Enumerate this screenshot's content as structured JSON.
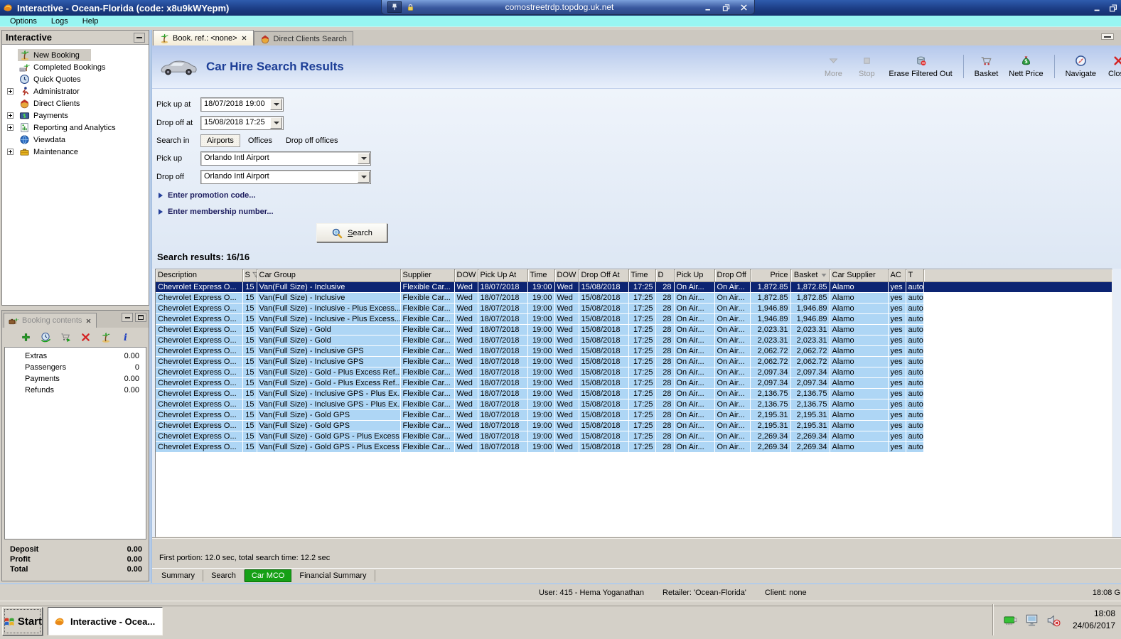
{
  "window": {
    "title": "Interactive - Ocean-Florida (code: x8u9kWYepm)"
  },
  "rdp_bar": {
    "host": "comostreetrdp.topdog.uk.net"
  },
  "menu": {
    "items": [
      "Options",
      "Logs",
      "Help"
    ]
  },
  "sidebar": {
    "title": "Interactive",
    "items": [
      {
        "icon": "palm",
        "label": "New Booking",
        "selected": true
      },
      {
        "icon": "palm-money",
        "label": "Completed Bookings"
      },
      {
        "icon": "clock",
        "label": "Quick Quotes"
      },
      {
        "icon": "runner",
        "label": "Administrator",
        "expandable": true
      },
      {
        "icon": "clients",
        "label": "Direct Clients"
      },
      {
        "icon": "payments",
        "label": "Payments",
        "expandable": true
      },
      {
        "icon": "report",
        "label": "Reporting and Analytics",
        "expandable": true
      },
      {
        "icon": "globe",
        "label": "Viewdata"
      },
      {
        "icon": "toolbox",
        "label": "Maintenance",
        "expandable": true
      }
    ]
  },
  "booking_panel": {
    "title": "Booking contents",
    "toolbar": [
      {
        "icon": "add",
        "name": "add-item-button"
      },
      {
        "icon": "world-clock",
        "name": "availability-button"
      },
      {
        "icon": "cart-add",
        "name": "add-to-basket-button"
      },
      {
        "icon": "close-red",
        "name": "delete-item-button"
      },
      {
        "icon": "palm",
        "name": "booking-button"
      },
      {
        "icon": "info",
        "name": "info-button"
      }
    ],
    "rows": [
      {
        "label": "Extras",
        "value": "0.00"
      },
      {
        "label": "Passengers",
        "value": "0"
      },
      {
        "label": "Payments",
        "value": "0.00"
      },
      {
        "label": "Refunds",
        "value": "0.00"
      }
    ],
    "totals": [
      {
        "label": "Deposit",
        "value": "0.00"
      },
      {
        "label": "Profit",
        "value": "0.00"
      },
      {
        "label": "Total",
        "value": "0.00"
      }
    ]
  },
  "tabs": [
    {
      "icon": "palm",
      "label": "Book. ref.: <none>",
      "active": true,
      "closable": true
    },
    {
      "icon": "clients",
      "label": "Direct Clients Search"
    }
  ],
  "page": {
    "title": "Car Hire Search Results",
    "toolbar": [
      {
        "icon": "more",
        "label": "More",
        "disabled": true
      },
      {
        "icon": "stop",
        "label": "Stop",
        "disabled": true
      },
      {
        "icon": "erase",
        "label": "Erase Filtered Out"
      },
      {
        "icon": "basket",
        "label": "Basket",
        "sep": true
      },
      {
        "icon": "nett",
        "label": "Nett Price"
      },
      {
        "icon": "navigate",
        "label": "Navigate",
        "sep": true
      },
      {
        "icon": "close-red",
        "label": "Close"
      }
    ]
  },
  "form": {
    "pickup_at": {
      "label": "Pick up at",
      "value": "18/07/2018 19:00"
    },
    "dropoff_at": {
      "label": "Drop off at",
      "value": "15/08/2018 17:25"
    },
    "search_in": {
      "label": "Search in",
      "options": [
        {
          "label": "Airports",
          "selected": true
        },
        {
          "label": "Offices"
        },
        {
          "label": "Drop off offices"
        }
      ]
    },
    "pickup": {
      "label": "Pick up",
      "value": "Orlando Intl Airport"
    },
    "dropoff": {
      "label": "Drop off",
      "value": "Orlando Intl Airport"
    },
    "promo": "Enter promotion code...",
    "membership": "Enter membership number...",
    "search_button": "Search"
  },
  "results": {
    "summary": "Search results: 16/16",
    "columns": [
      {
        "label": "Description"
      },
      {
        "label": "S",
        "icon": "filter"
      },
      {
        "label": "Car Group"
      },
      {
        "label": "Supplier"
      },
      {
        "label": "DOW"
      },
      {
        "label": "Pick Up At"
      },
      {
        "label": "Time"
      },
      {
        "label": "DOW"
      },
      {
        "label": "Drop Off At"
      },
      {
        "label": "Time"
      },
      {
        "label": "D"
      },
      {
        "label": "Pick Up"
      },
      {
        "label": "Drop Off"
      },
      {
        "label": "Price"
      },
      {
        "label": "Basket",
        "icon": "sort-desc"
      },
      {
        "label": "Car Supplier"
      },
      {
        "label": "AC"
      },
      {
        "label": "T"
      }
    ],
    "selected_row": 0,
    "rows": [
      [
        "Chevrolet Express O...",
        "15",
        "Van(Full Size) - Inclusive",
        "Flexible Car...",
        "Wed",
        "18/07/2018",
        "19:00",
        "Wed",
        "15/08/2018",
        "17:25",
        "28",
        "On Air...",
        "On Air...",
        "1,872.85",
        "1,872.85",
        "Alamo",
        "yes",
        "auto"
      ],
      [
        "Chevrolet Express O...",
        "15",
        "Van(Full Size) - Inclusive",
        "Flexible Car...",
        "Wed",
        "18/07/2018",
        "19:00",
        "Wed",
        "15/08/2018",
        "17:25",
        "28",
        "On Air...",
        "On Air...",
        "1,872.85",
        "1,872.85",
        "Alamo",
        "yes",
        "auto"
      ],
      [
        "Chevrolet Express O...",
        "15",
        "Van(Full Size) - Inclusive - Plus Excess...",
        "Flexible Car...",
        "Wed",
        "18/07/2018",
        "19:00",
        "Wed",
        "15/08/2018",
        "17:25",
        "28",
        "On Air...",
        "On Air...",
        "1,946.89",
        "1,946.89",
        "Alamo",
        "yes",
        "auto"
      ],
      [
        "Chevrolet Express O...",
        "15",
        "Van(Full Size) - Inclusive - Plus Excess...",
        "Flexible Car...",
        "Wed",
        "18/07/2018",
        "19:00",
        "Wed",
        "15/08/2018",
        "17:25",
        "28",
        "On Air...",
        "On Air...",
        "1,946.89",
        "1,946.89",
        "Alamo",
        "yes",
        "auto"
      ],
      [
        "Chevrolet Express O...",
        "15",
        "Van(Full Size) - Gold",
        "Flexible Car...",
        "Wed",
        "18/07/2018",
        "19:00",
        "Wed",
        "15/08/2018",
        "17:25",
        "28",
        "On Air...",
        "On Air...",
        "2,023.31",
        "2,023.31",
        "Alamo",
        "yes",
        "auto"
      ],
      [
        "Chevrolet Express O...",
        "15",
        "Van(Full Size) - Gold",
        "Flexible Car...",
        "Wed",
        "18/07/2018",
        "19:00",
        "Wed",
        "15/08/2018",
        "17:25",
        "28",
        "On Air...",
        "On Air...",
        "2,023.31",
        "2,023.31",
        "Alamo",
        "yes",
        "auto"
      ],
      [
        "Chevrolet Express O...",
        "15",
        "Van(Full Size) - Inclusive GPS",
        "Flexible Car...",
        "Wed",
        "18/07/2018",
        "19:00",
        "Wed",
        "15/08/2018",
        "17:25",
        "28",
        "On Air...",
        "On Air...",
        "2,062.72",
        "2,062.72",
        "Alamo",
        "yes",
        "auto"
      ],
      [
        "Chevrolet Express O...",
        "15",
        "Van(Full Size) - Inclusive GPS",
        "Flexible Car...",
        "Wed",
        "18/07/2018",
        "19:00",
        "Wed",
        "15/08/2018",
        "17:25",
        "28",
        "On Air...",
        "On Air...",
        "2,062.72",
        "2,062.72",
        "Alamo",
        "yes",
        "auto"
      ],
      [
        "Chevrolet Express O...",
        "15",
        "Van(Full Size) - Gold - Plus Excess Ref...",
        "Flexible Car...",
        "Wed",
        "18/07/2018",
        "19:00",
        "Wed",
        "15/08/2018",
        "17:25",
        "28",
        "On Air...",
        "On Air...",
        "2,097.34",
        "2,097.34",
        "Alamo",
        "yes",
        "auto"
      ],
      [
        "Chevrolet Express O...",
        "15",
        "Van(Full Size) - Gold - Plus Excess Ref...",
        "Flexible Car...",
        "Wed",
        "18/07/2018",
        "19:00",
        "Wed",
        "15/08/2018",
        "17:25",
        "28",
        "On Air...",
        "On Air...",
        "2,097.34",
        "2,097.34",
        "Alamo",
        "yes",
        "auto"
      ],
      [
        "Chevrolet Express O...",
        "15",
        "Van(Full Size) - Inclusive GPS - Plus Ex...",
        "Flexible Car...",
        "Wed",
        "18/07/2018",
        "19:00",
        "Wed",
        "15/08/2018",
        "17:25",
        "28",
        "On Air...",
        "On Air...",
        "2,136.75",
        "2,136.75",
        "Alamo",
        "yes",
        "auto"
      ],
      [
        "Chevrolet Express O...",
        "15",
        "Van(Full Size) - Inclusive GPS - Plus Ex...",
        "Flexible Car...",
        "Wed",
        "18/07/2018",
        "19:00",
        "Wed",
        "15/08/2018",
        "17:25",
        "28",
        "On Air...",
        "On Air...",
        "2,136.75",
        "2,136.75",
        "Alamo",
        "yes",
        "auto"
      ],
      [
        "Chevrolet Express O...",
        "15",
        "Van(Full Size) - Gold GPS",
        "Flexible Car...",
        "Wed",
        "18/07/2018",
        "19:00",
        "Wed",
        "15/08/2018",
        "17:25",
        "28",
        "On Air...",
        "On Air...",
        "2,195.31",
        "2,195.31",
        "Alamo",
        "yes",
        "auto"
      ],
      [
        "Chevrolet Express O...",
        "15",
        "Van(Full Size) - Gold GPS",
        "Flexible Car...",
        "Wed",
        "18/07/2018",
        "19:00",
        "Wed",
        "15/08/2018",
        "17:25",
        "28",
        "On Air...",
        "On Air...",
        "2,195.31",
        "2,195.31",
        "Alamo",
        "yes",
        "auto"
      ],
      [
        "Chevrolet Express O...",
        "15",
        "Van(Full Size) - Gold GPS - Plus Excess...",
        "Flexible Car...",
        "Wed",
        "18/07/2018",
        "19:00",
        "Wed",
        "15/08/2018",
        "17:25",
        "28",
        "On Air...",
        "On Air...",
        "2,269.34",
        "2,269.34",
        "Alamo",
        "yes",
        "auto"
      ],
      [
        "Chevrolet Express O...",
        "15",
        "Van(Full Size) - Gold GPS - Plus Excess...",
        "Flexible Car...",
        "Wed",
        "18/07/2018",
        "19:00",
        "Wed",
        "15/08/2018",
        "17:25",
        "28",
        "On Air...",
        "On Air...",
        "2,269.34",
        "2,269.34",
        "Alamo",
        "yes",
        "auto"
      ]
    ],
    "status": "First portion: 12.0 sec, total search time: 12.2 sec"
  },
  "bottom_tabs": [
    {
      "label": "Summary"
    },
    {
      "label": "Search"
    },
    {
      "label": "Car MCO",
      "active": true
    },
    {
      "label": "Financial Summary"
    }
  ],
  "status_bar": {
    "user": "User: 415 - Hema Yoganathan",
    "retailer": "Retailer: 'Ocean-Florida'",
    "client": "Client: none",
    "right": "18:08 G"
  },
  "taskbar": {
    "start": "Start",
    "task": "Interactive - Ocea...",
    "time": "18:08",
    "date": "24/06/2017"
  }
}
